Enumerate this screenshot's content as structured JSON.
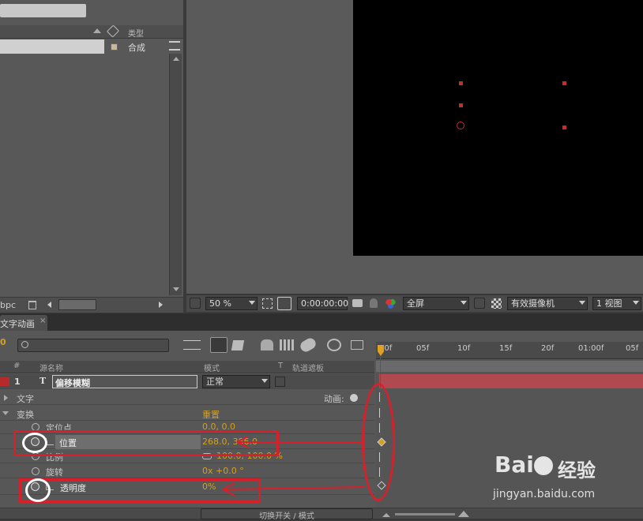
{
  "project_panel": {
    "column_type": "类型",
    "item_type": "合成",
    "bpc": "bpc"
  },
  "viewer_toolbar": {
    "zoom": "50 %",
    "timecode": "0:00:00:00",
    "resolution": "全屏",
    "camera": "有效摄像机",
    "views": "1 视图"
  },
  "timeline": {
    "tab_label": "文字动画",
    "search_placeholder": "",
    "ruler_ticks": [
      "00f",
      "05f",
      "10f",
      "15f",
      "20f",
      "01:00f",
      "05f"
    ],
    "col_num": "#",
    "col_source": "源名称",
    "col_mode": "模式",
    "col_t": "T",
    "col_trackmatte": "轨道遮板",
    "layer": {
      "index": "1",
      "name": "偏移模糊",
      "mode": "正常"
    },
    "text_group": "文字",
    "animate_label": "动画:",
    "transform_group": "变换",
    "reset_label": "重置",
    "props": [
      {
        "name": "定位点",
        "value": "0.0, 0.0"
      },
      {
        "name": "位置",
        "value": "268.0, 386.0"
      },
      {
        "name": "比例",
        "value": "100.0, 100.0 %"
      },
      {
        "name": "旋转",
        "value": "0x +0.0 °"
      },
      {
        "name": "透明度",
        "value": "0%"
      }
    ],
    "toggle_label": "切换开关 / 模式"
  },
  "watermark": {
    "brand": "Bai",
    "brand2": "经验",
    "url": "jingyan.baidu.com"
  },
  "colors": {
    "annotation_red": "#d8202a",
    "value_gold": "#d4a020",
    "layer_bar": "#b04a50"
  }
}
